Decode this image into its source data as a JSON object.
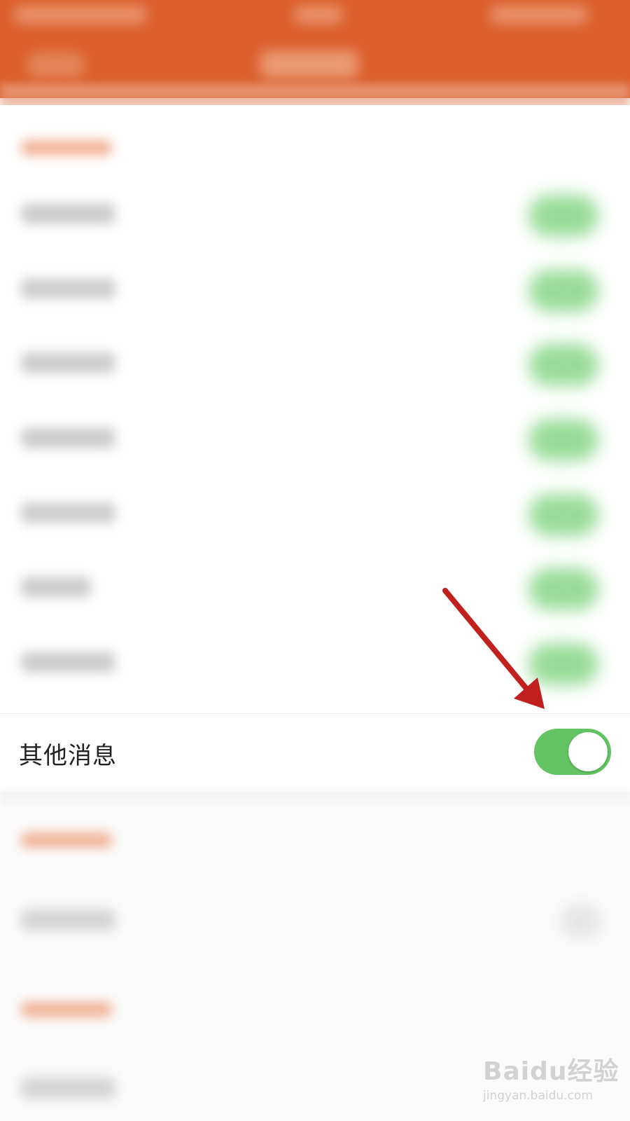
{
  "header": {
    "background_color": "#dc5f2c"
  },
  "settings_row": {
    "label": "其他消息",
    "toggle_state": "on",
    "toggle_color": "#62c462"
  },
  "annotation": {
    "arrow_color": "#c0201e",
    "points_to": "settings_row.toggle"
  },
  "watermark": {
    "brand": "Baidu经验",
    "domain": "jingyan.baidu.com"
  }
}
